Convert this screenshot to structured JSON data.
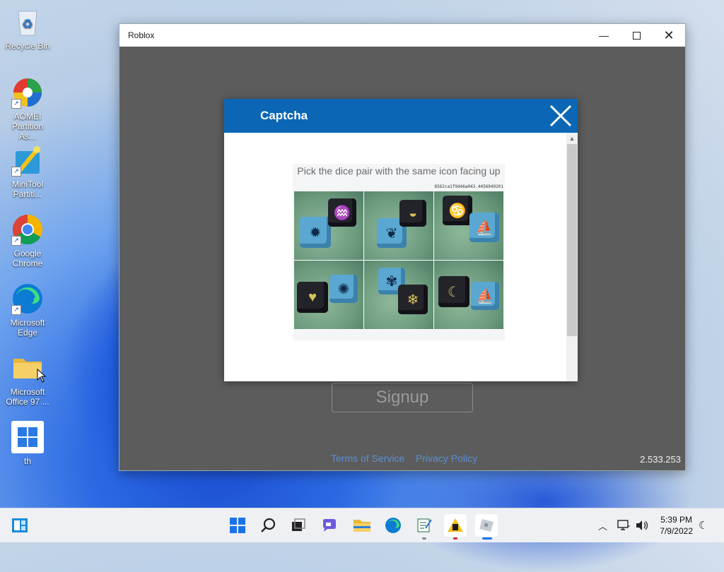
{
  "desktop": {
    "icons": [
      {
        "label": "Recycle Bin"
      },
      {
        "label": "AOMEI Partition As..."
      },
      {
        "label": "MiniTool Partiti..."
      },
      {
        "label": "Google Chrome"
      },
      {
        "label": "Microsoft Edge"
      },
      {
        "label": "Microsoft Office 97 ..."
      },
      {
        "label": "th"
      }
    ]
  },
  "window": {
    "title": "Roblox",
    "signup_label": "Signup",
    "terms_label": "Terms of Service",
    "privacy_label": "Privacy Policy",
    "version": "2.533.253"
  },
  "captcha": {
    "title": "Captcha",
    "prompt": "Pick the dice pair with the same icon facing up",
    "hash": "8562ca1f9d46a043.4456949201",
    "tiles": [
      {
        "left_icon": "sun-icon",
        "right_icon": "swirl-icon"
      },
      {
        "left_icon": "leaf-icon",
        "right_icon": "bowl-icon"
      },
      {
        "left_icon": "swirl-icon",
        "right_icon": "bird-icon"
      },
      {
        "left_icon": "heart-icon",
        "right_icon": "spiral-icon"
      },
      {
        "left_icon": "flower-icon",
        "right_icon": "snowflake-icon"
      },
      {
        "left_icon": "moon-icon",
        "right_icon": "bird-icon"
      }
    ]
  },
  "taskbar": {
    "time": "5:39 PM",
    "date": "7/9/2022"
  },
  "colors": {
    "captcha_header": "#0b67b5",
    "window_bg": "#5c5c5c",
    "link": "#5d8fcf"
  }
}
